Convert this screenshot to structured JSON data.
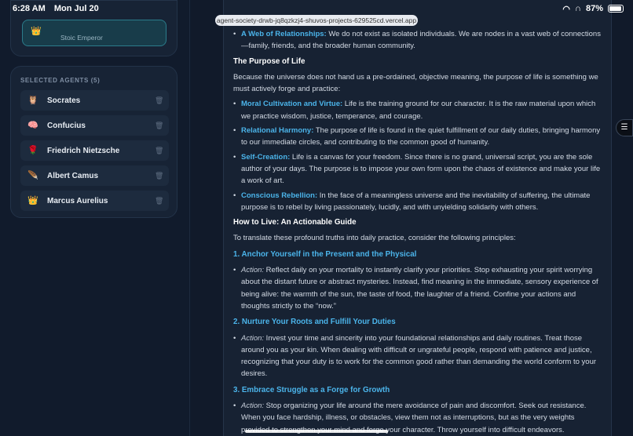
{
  "status": {
    "time": "6:28 AM",
    "date": "Mon Jul 20",
    "battery": "87%"
  },
  "url": "agent-society-drwb-jq8qzkzj4-shuvos-projects-629525cd.vercel.app",
  "sidebar": {
    "emperor_subtitle": "Stoic Emperor",
    "heading": "SELECTED AGENTS (5)",
    "agents": [
      {
        "name": "Socrates",
        "icon": "owl"
      },
      {
        "name": "Confucius",
        "icon": "brain"
      },
      {
        "name": "Friedrich Nietzsche",
        "icon": "rose"
      },
      {
        "name": "Albert Camus",
        "icon": "feather"
      },
      {
        "name": "Marcus Aurelius",
        "icon": "crown"
      }
    ]
  },
  "content": {
    "b0_kw": "A Web of Relationships:",
    "b0_text": " We do not exist as isolated individuals. We are nodes in a vast web of connections—family, friends, and the broader human community.",
    "h_purpose": "The Purpose of Life",
    "p_purpose": "Because the universe does not hand us a pre-ordained, objective meaning, the purpose of life is something we must actively forge and practice:",
    "b1_kw": "Moral Cultivation and Virtue:",
    "b1_text": " Life is the training ground for our character. It is the raw material upon which we practice wisdom, justice, temperance, and courage.",
    "b2_kw": "Relational Harmony:",
    "b2_text": " The purpose of life is found in the quiet fulfillment of our daily duties, bringing harmony to our immediate circles, and contributing to the common good of humanity.",
    "b3_kw": "Self-Creation:",
    "b3_text": " Life is a canvas for your freedom. Since there is no grand, universal script, you are the sole author of your days. The purpose is to impose your own form upon the chaos of existence and make your life a work of art.",
    "b4_kw": "Conscious Rebellion:",
    "b4_text": " In the face of a meaningless universe and the inevitability of suffering, the ultimate purpose is to rebel by living passionately, lucidly, and with unyielding solidarity with others.",
    "h_howto": "How to Live: An Actionable Guide",
    "p_howto": "To translate these profound truths into daily practice, consider the following principles:",
    "s1_title": "1. Anchor Yourself in the Present and the Physical",
    "s1_action": "Action:",
    "s1_text": " Reflect daily on your mortality to instantly clarify your priorities. Stop exhausting your spirit worrying about the distant future or abstract mysteries. Instead, find meaning in the immediate, sensory experience of being alive: the warmth of the sun, the taste of food, the laughter of a friend. Confine your actions and thoughts strictly to the “now.”",
    "s2_title": "2. Nurture Your Roots and Fulfill Your Duties",
    "s2_action": "Action:",
    "s2_text": " Invest your time and sincerity into your foundational relationships and daily routines. Treat those around you as your kin. When dealing with difficult or ungrateful people, respond with patience and justice, recognizing that your duty is to work for the common good rather than demanding the world conform to your desires.",
    "s3_title": "3. Embrace Struggle as a Forge for Growth",
    "s3_action": "Action:",
    "s3_text": " Stop organizing your life around the mere avoidance of pain and discomfort. Seek out resistance. When you face hardship, illness, or obstacles, view them not as interruptions, but as the very weights provided to strengthen your mind and forge your character. Throw yourself into difficult endeavors."
  }
}
